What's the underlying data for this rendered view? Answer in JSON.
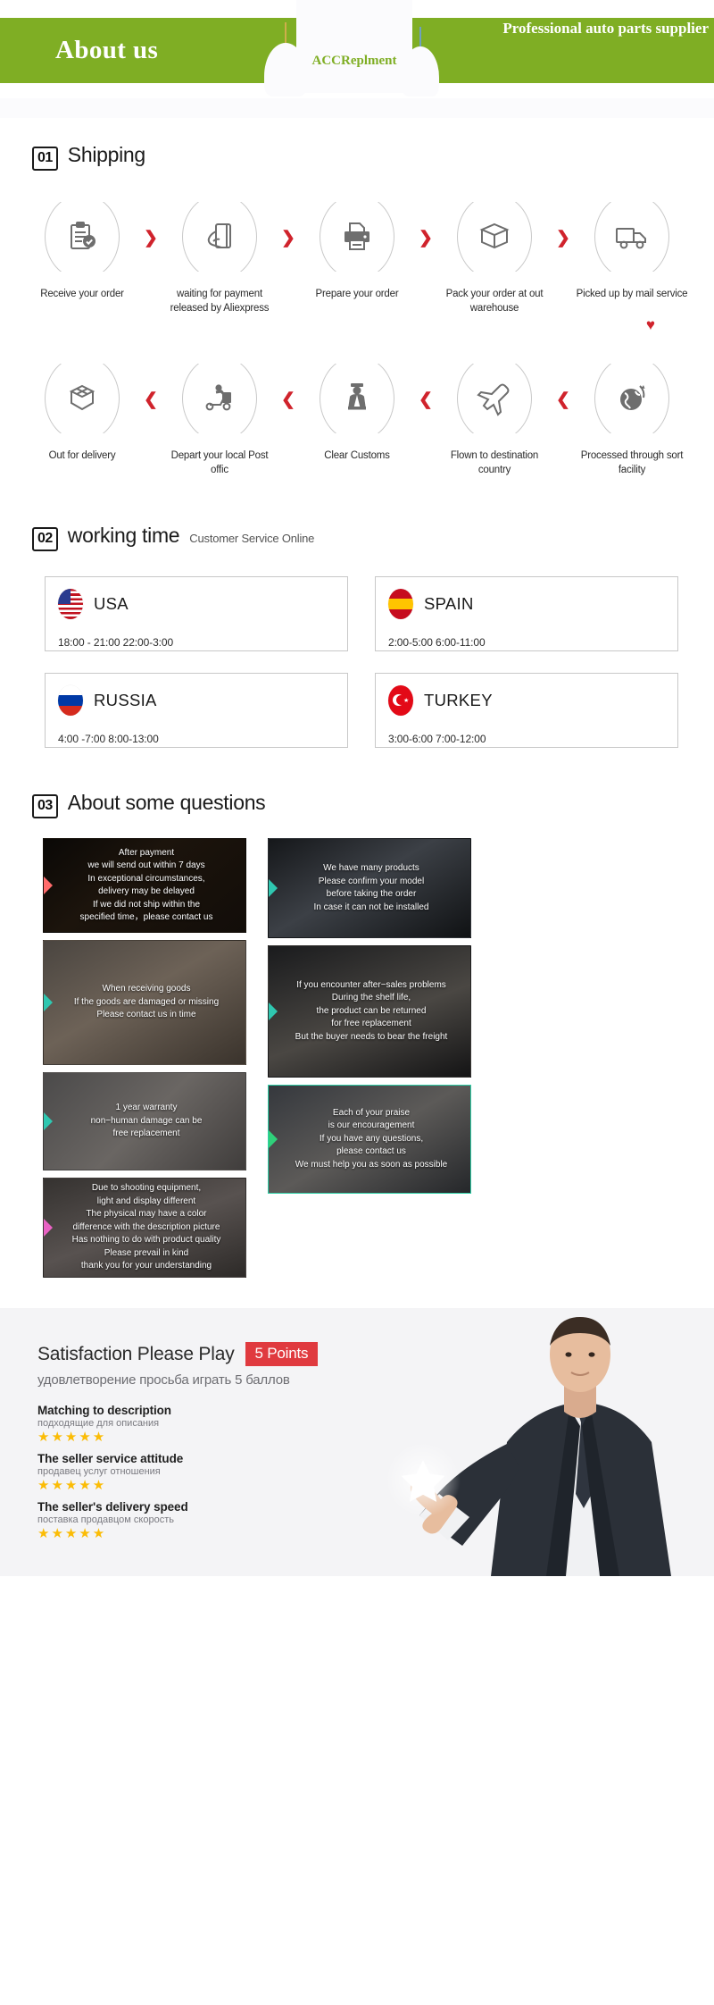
{
  "banner": {
    "title": "About us",
    "subtitle": "Professional auto parts supplier",
    "logo_text": "ACCReplment",
    "green": "#7fae24"
  },
  "shipping": {
    "number": "01",
    "title": "Shipping",
    "arrow_right": "❯",
    "arrow_left": "❮",
    "turn_marker": "♥",
    "row1": [
      {
        "icon": "clipboard-check-icon",
        "label": "Receive your order"
      },
      {
        "icon": "hand-card-icon",
        "label": "waiting for payment\nreleased by Aliexpress"
      },
      {
        "icon": "printer-icon",
        "label": "Prepare your order"
      },
      {
        "icon": "package-box-icon",
        "label": "Pack your order at\nout warehouse"
      },
      {
        "icon": "delivery-truck-icon",
        "label": "Picked up by\nmail service"
      }
    ],
    "row2": [
      {
        "icon": "open-box-icon",
        "label": "Out  for delivery"
      },
      {
        "icon": "scooter-courier-icon",
        "label": "Depart your local\nPost offic"
      },
      {
        "icon": "customs-officer-icon",
        "label": "Clear Customs"
      },
      {
        "icon": "airplane-icon",
        "label": "Flown to\ndestination country"
      },
      {
        "icon": "globe-icon",
        "label": "Processed through\nsort facility"
      }
    ]
  },
  "working_time": {
    "number": "02",
    "title": "working time",
    "subtitle": "Customer Service Online",
    "cards": [
      {
        "flag": "usa-flag-icon",
        "country": "USA",
        "hours": "18:00 - 21:00   22:00-3:00"
      },
      {
        "flag": "spain-flag-icon",
        "country": "SPAIN",
        "hours": "2:00-5:00     6:00-11:00"
      },
      {
        "flag": "russia-flag-icon",
        "country": "RUSSIA",
        "hours": "4:00 -7:00   8:00-13:00"
      },
      {
        "flag": "turkey-flag-icon",
        "country": "TURKEY",
        "hours": "3:00-6:00    7:00-12:00"
      }
    ]
  },
  "faq": {
    "number": "03",
    "title": "About some questions",
    "left": [
      "After payment\nwe will send out within 7 days\nIn exceptional circumstances,\ndelivery may be delayed\nIf we did not ship within the\nspecified time，please contact us",
      "When receiving goods\nIf the goods are damaged or missing\nPlease contact us in time",
      "1 year warranty\nnon−human damage can be\nfree replacement",
      "Due to shooting equipment,\nlight and display different\nThe physical may have a color\ndifference with the description picture\nHas nothing to do with product quality\nPlease prevail in kind\nthank you for your understanding"
    ],
    "right": [
      "We have many products\nPlease confirm your model\nbefore taking the order\nIn case it can not be installed",
      "If you encounter after−sales problems\nDuring the shelf life,\nthe product can be returned\nfor free replacement\nBut the buyer needs to bear the freight",
      "Each of your praise\nis our encouragement\nIf you have any questions,\nplease contact us\nWe must help you as soon as possible"
    ]
  },
  "satisfaction": {
    "title": "Satisfaction Please Play",
    "badge": "5 Points",
    "subtitle_ru": "удовлетворение просьба играть 5 баллов",
    "badge_color": "#e03a3f",
    "star_color": "#fbbc05",
    "ratings": [
      {
        "en": "Matching to description",
        "ru": "подходящие для описания",
        "stars": "★★★★★"
      },
      {
        "en": "The seller service attitude",
        "ru": "продавец услуг отношения",
        "stars": "★★★★★"
      },
      {
        "en": "The seller's delivery speed",
        "ru": "поставка продавцом скорость",
        "stars": "★★★★★"
      }
    ]
  }
}
